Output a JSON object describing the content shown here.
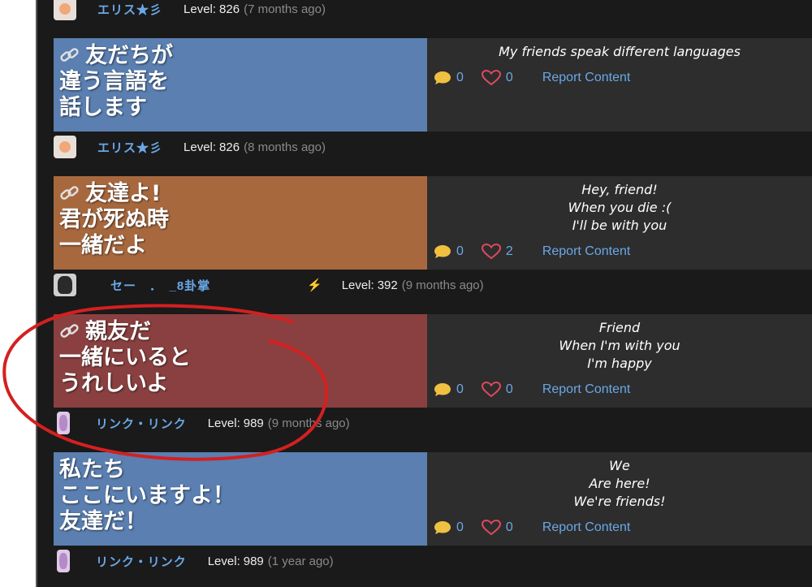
{
  "colors": {
    "blue_panel": "#5a7fb0",
    "orange_panel": "#a8683e",
    "red_panel": "#8a4040",
    "accent": "#6aa8e8",
    "circle": "#d42020"
  },
  "user_rows": [
    {
      "name": "エリス★彡",
      "level_label": "Level:",
      "level": "826",
      "time": "(7 months ago)"
    },
    {
      "name": "エリス★彡",
      "level_label": "Level:",
      "level": "826",
      "time": "(8 months ago)"
    },
    {
      "name": "セー　．　_8卦掌",
      "level_label": "Level:",
      "level": "392",
      "time": "(9 months ago)"
    },
    {
      "name": "リンク・リンク",
      "level_label": "Level:",
      "level": "989",
      "time": "(9 months ago)"
    },
    {
      "name": "リンク・リンク",
      "level_label": "Level:",
      "level": "989",
      "time": "(1 year ago)"
    }
  ],
  "posts": [
    {
      "jp_lines": [
        "友だちが",
        "違う言語を",
        "話します"
      ],
      "has_link_icon": true,
      "panel_color": "#5a7fb0",
      "en_lines": [
        "My friends speak different languages"
      ],
      "comments": "0",
      "likes": "0",
      "report_label": "Report Content"
    },
    {
      "jp_lines": [
        "友達よ!",
        "君が死ぬ時",
        "一緒だよ"
      ],
      "has_link_icon": true,
      "panel_color": "#a8683e",
      "en_lines": [
        "Hey, friend!",
        "When you die :(",
        "I'll be with you"
      ],
      "comments": "0",
      "likes": "2",
      "report_label": "Report Content"
    },
    {
      "jp_lines": [
        "親友だ",
        "一緒にいると",
        "うれしいよ"
      ],
      "has_link_icon": true,
      "panel_color": "#8a4040",
      "en_lines": [
        "Friend",
        "When I'm with you",
        "I'm happy"
      ],
      "comments": "0",
      "likes": "0",
      "report_label": "Report Content"
    },
    {
      "jp_lines": [
        "私たち",
        "ここにいますよ！",
        "友達だ！"
      ],
      "has_link_icon": false,
      "panel_color": "#5a7fb0",
      "en_lines": [
        "We",
        "Are here!",
        "We're friends!"
      ],
      "comments": "0",
      "likes": "0",
      "report_label": "Report Content"
    }
  ]
}
